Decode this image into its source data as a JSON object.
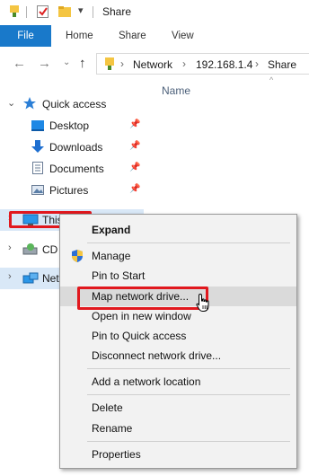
{
  "window": {
    "title": "Share"
  },
  "ribbon": {
    "tabs": [
      "File",
      "Home",
      "Share",
      "View"
    ]
  },
  "address": {
    "crumbs": [
      "Network",
      "192.168.1.4",
      "Share"
    ]
  },
  "columns": {
    "name": "Name"
  },
  "nav": {
    "quick_access": "Quick access",
    "pinned": [
      "Desktop",
      "Downloads",
      "Documents",
      "Pictures"
    ],
    "this_pc": "This",
    "cd": "CD",
    "network": "Net"
  },
  "context_menu": {
    "items": [
      "Expand",
      "Manage",
      "Pin to Start",
      "Map network drive...",
      "Open in new window",
      "Pin to Quick access",
      "Disconnect network drive...",
      "Add a network location",
      "Delete",
      "Rename",
      "Properties"
    ],
    "highlighted": "Map network drive..."
  },
  "colors": {
    "accent": "#1979ca",
    "highlight_box": "#e1181e",
    "menu_bg": "#f2f2f2"
  }
}
